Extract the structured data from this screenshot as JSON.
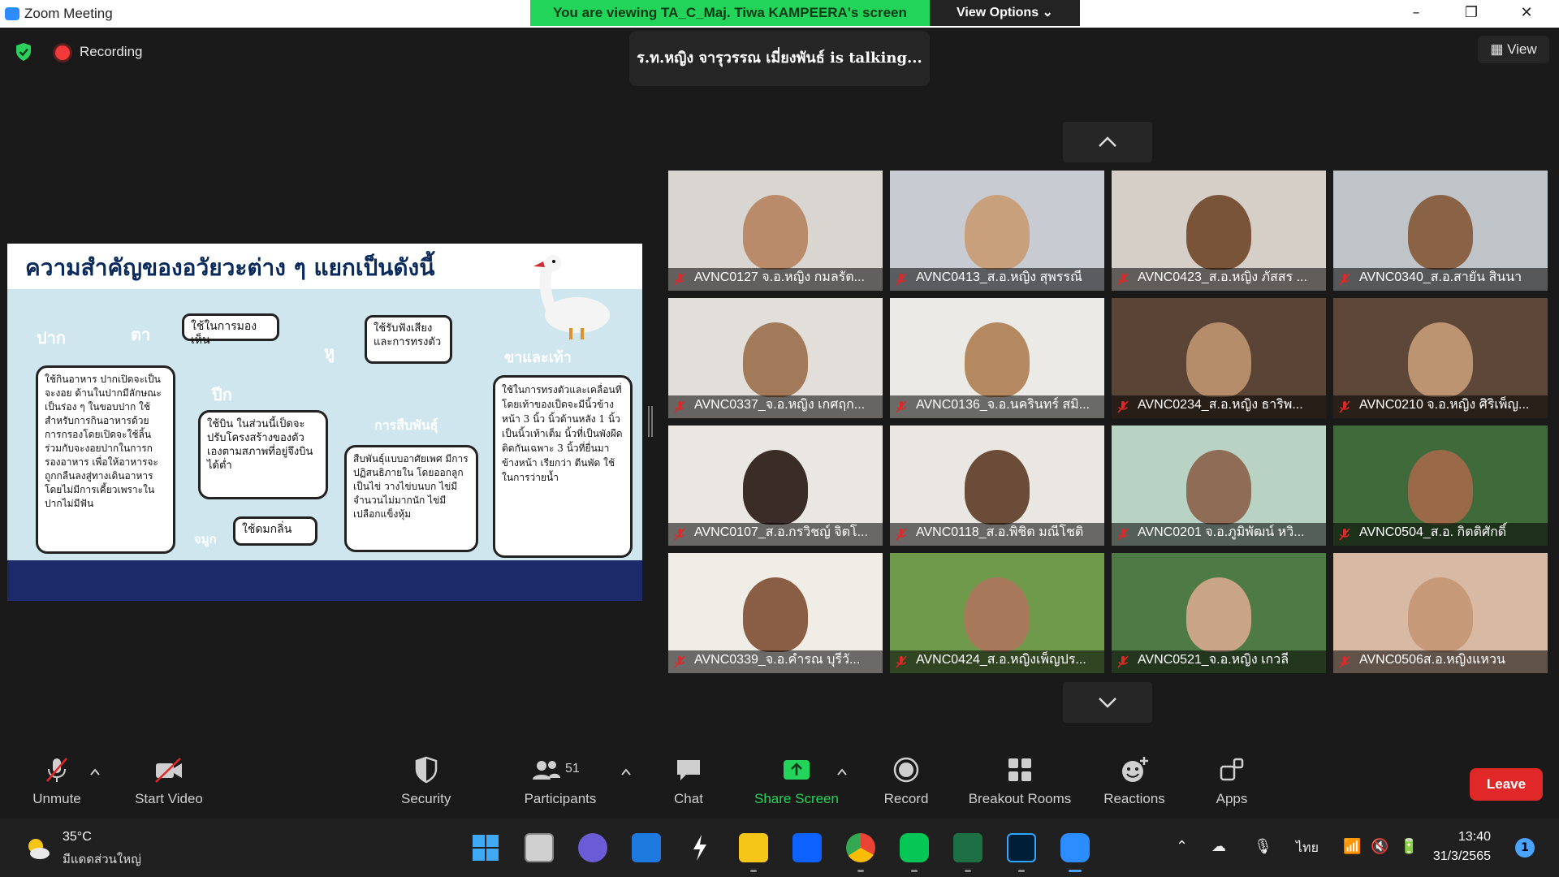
{
  "window": {
    "title": "Zoom Meeting",
    "banner": "You are viewing TA_C_Maj. Tiwa KAMPEERA's screen",
    "view_options": "View Options",
    "minimize": "–",
    "maximize": "❐",
    "close": "✕"
  },
  "meeting": {
    "recording_label": "Recording",
    "talking": "ร.ท.หญิง จารุวรรณ เมี่ยงพันธ์ is talking...",
    "view_label": "View"
  },
  "shared_slide": {
    "title": "ความสำคัญของอวัยวะต่าง ๆ แยกเป็นดังนี้",
    "pennants": {
      "mouth": "ปาก",
      "eye": "ตา",
      "ear": "หู",
      "wing": "ปีก",
      "reproduction": "การสืบพันธุ์",
      "legs": "ขาและเท้า",
      "nose": "จมูก"
    },
    "bubbles": {
      "eye_text": "ใช้ในการมองเห็น",
      "ear_text": "ใช้รับฟังเสียง และการทรงตัว",
      "mouth_text": "ใช้กินอาหาร ปากเปิดจะเป็นจะงอย ด้านในปากมีลักษณะเป็นร่อง ๆ ในขอบปาก ใช้สำหรับการกินอาหารด้วยการกรองโดยเปิดจะใช้ลิ้นร่วมกับจะงอยปากในการกรองอาหาร เพื่อให้อาหารจะถูกกลืนลงสู่ทางเดินอาหาร โดยไม่มีการเคี้ยวเพราะในปากไม่มีฟัน",
      "wing_text": "ใช้บิน ในส่วนนี้เป็ดจะปรับโครงสร้างของตัวเองตามสภาพที่อยู่จึงบินได้ต่ำ",
      "reproduction_text": "สืบพันธุ์แบบอาศัยเพศ มีการปฏิสนธิภายใน โดยออกลูกเป็นไข่ วางไข่บนบก ไข่มีจำนวนไม่มากนัก ไข่มีเปลือกแข็งหุ้ม",
      "legs_text": "ใช้ในการทรงตัวและเคลื่อนที่ โดยเท้าของเป็ดจะมีนิ้วข้างหน้า 3 นิ้ว นิ้วด้านหลัง 1 นิ้ว เป็นนิ้วเท้าเต็ม นิ้วที่เป็นพังผืดติดกันเฉพาะ 3 นิ้วที่ยื่นมาข้างหน้า เรียกว่า ตีนพัด ใช้ในการว่ายน้ำ",
      "nose_text": "ใช้ดมกลิ่น"
    }
  },
  "participants": [
    {
      "name": "AVNC0127 จ.อ.หญิง กมลรัต...",
      "bg": "#d9d6d2",
      "skin": "#b98b6b"
    },
    {
      "name": "AVNC0413_ส.อ.หญิง สุพรรณี",
      "bg": "#c8ccd2",
      "skin": "#c9a07c"
    },
    {
      "name": "AVNC0423_ส.อ.หญิง ภัสสร ...",
      "bg": "#d5cfc8",
      "skin": "#7a5438"
    },
    {
      "name": "AVNC0340_ส.อ.สายัน สินนา",
      "bg": "#bfc4c8",
      "skin": "#8a6347"
    },
    {
      "name": "AVNC0337_จ.อ.หญิง เกศฤก...",
      "bg": "#e2dfdb",
      "skin": "#a27a5a"
    },
    {
      "name": "AVNC0136_จ.อ.นครินทร์ สมิ...",
      "bg": "#eceae6",
      "skin": "#b5895f"
    },
    {
      "name": "AVNC0234_ส.อ.หญิง ธาริพ...",
      "bg": "#5a4436",
      "skin": "#b58d6b"
    },
    {
      "name": "AVNC0210 จ.อ.หญิง ศิริเพ็ญ...",
      "bg": "#5c4738",
      "skin": "#bd9472"
    },
    {
      "name": "AVNC0107_ส.อ.กรวิชญ์ จิตโ...",
      "bg": "#eae7e2",
      "skin": "#3a2c26"
    },
    {
      "name": "AVNC0118_ส.อ.พิชิต มณีโชติ",
      "bg": "#eae7e2",
      "skin": "#6b4c38"
    },
    {
      "name": "AVNC0201 จ.อ.ภูมิพัฒน์ หวิ...",
      "bg": "#b8d2c4",
      "skin": "#8f6c55"
    },
    {
      "name": "AVNC0504_ส.อ. กิตติศักดิ์",
      "bg": "#3f6b3a",
      "skin": "#9a6a48"
    },
    {
      "name": "AVNC0339_จ.อ.คำรณ บุรีวั...",
      "bg": "#f0ece6",
      "skin": "#8a5e44"
    },
    {
      "name": "AVNC0424_ส.อ.หญิงเพ็ญปร...",
      "bg": "#6f9a4c",
      "skin": "#a8785a"
    },
    {
      "name": "AVNC0521_จ.อ.หญิง เกวลี",
      "bg": "#4e7a45",
      "skin": "#c9a486"
    },
    {
      "name": "AVNC0506ส.อ.หญิงแหวน",
      "bg": "#d8b9a4",
      "skin": "#c69978"
    }
  ],
  "toolbar": {
    "unmute": "Unmute",
    "start_video": "Start Video",
    "security": "Security",
    "participants": "Participants",
    "participant_count": "51",
    "chat": "Chat",
    "share_screen": "Share Screen",
    "record": "Record",
    "breakout_rooms": "Breakout Rooms",
    "reactions": "Reactions",
    "apps": "Apps",
    "leave": "Leave"
  },
  "taskbar": {
    "temperature": "35°C",
    "weather": "มีแดดส่วนใหญ่",
    "language": "ไทย",
    "time": "13:40",
    "date": "31/3/2565",
    "notifications": "1"
  },
  "colors": {
    "banner_green": "#23d45a",
    "share_green": "#23d45a",
    "leave_red": "#e02828"
  }
}
